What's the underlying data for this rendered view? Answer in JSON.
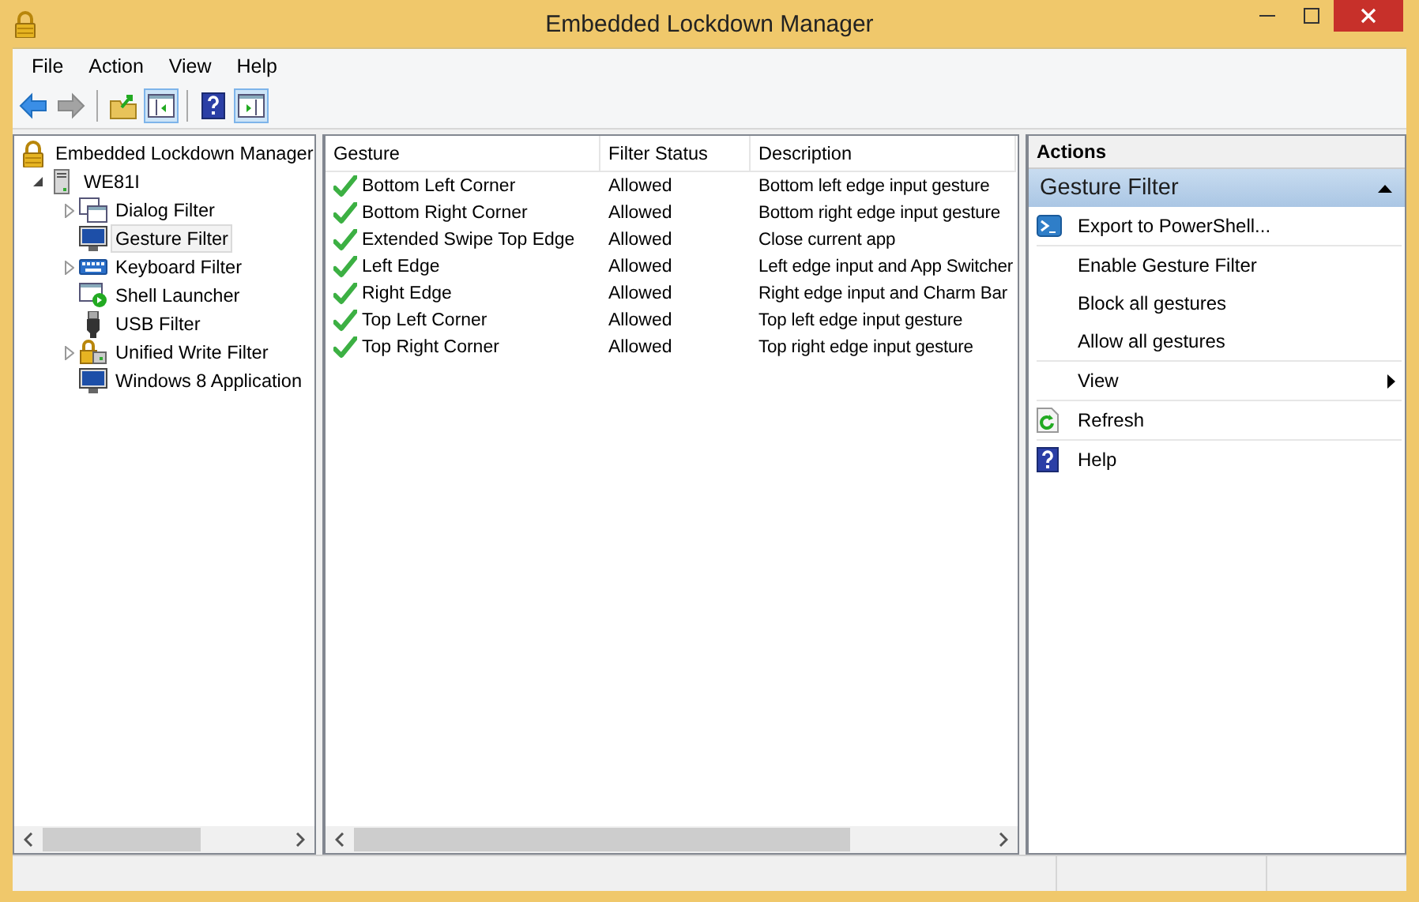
{
  "window": {
    "title": "Embedded Lockdown Manager"
  },
  "menu": [
    {
      "label": "File"
    },
    {
      "label": "Action"
    },
    {
      "label": "View"
    },
    {
      "label": "Help"
    }
  ],
  "toolbar": [
    {
      "pressed": false,
      "disabled": false
    },
    {
      "pressed": false,
      "disabled": true
    },
    {
      "pressed": false,
      "disabled": false
    },
    {
      "pressed": true,
      "disabled": false
    },
    {
      "pressed": false,
      "disabled": false
    },
    {
      "pressed": true,
      "disabled": false
    }
  ],
  "tree": [
    {
      "label": "Embedded Lockdown Manager",
      "expandable": false,
      "selected": false,
      "children": [
        {
          "label": "WE81I",
          "expandable": true,
          "expanded": true,
          "selected": false,
          "children": [
            {
              "label": "Dialog Filter",
              "expandable": true,
              "expanded": false,
              "selected": false
            },
            {
              "label": "Gesture Filter",
              "expandable": false,
              "selected": true
            },
            {
              "label": "Keyboard Filter",
              "expandable": true,
              "expanded": false,
              "selected": false
            },
            {
              "label": "Shell Launcher",
              "expandable": false,
              "selected": false
            },
            {
              "label": "USB Filter",
              "expandable": false,
              "selected": false
            },
            {
              "label": "Unified Write Filter",
              "expandable": true,
              "expanded": false,
              "selected": false
            },
            {
              "label": "Windows 8 Application",
              "expandable": false,
              "selected": false
            }
          ]
        }
      ]
    }
  ],
  "table": {
    "columns": [
      "Gesture",
      "Filter Status",
      "Description"
    ],
    "rows": [
      {
        "gesture": "Bottom Left Corner",
        "status": "Allowed",
        "description": "Bottom left edge input gesture",
        "allowed": true
      },
      {
        "gesture": "Bottom Right Corner",
        "status": "Allowed",
        "description": "Bottom right edge input gesture",
        "allowed": true
      },
      {
        "gesture": "Extended Swipe Top Edge",
        "status": "Allowed",
        "description": "Close current app",
        "allowed": true
      },
      {
        "gesture": "Left Edge",
        "status": "Allowed",
        "description": "Left edge input and App Switcher",
        "allowed": true
      },
      {
        "gesture": "Right Edge",
        "status": "Allowed",
        "description": "Right edge input and Charm Bar",
        "allowed": true
      },
      {
        "gesture": "Top Left Corner",
        "status": "Allowed",
        "description": "Top left edge input gesture",
        "allowed": true
      },
      {
        "gesture": "Top Right Corner",
        "status": "Allowed",
        "description": "Top right edge input gesture",
        "allowed": true
      }
    ]
  },
  "actions": {
    "title": "Actions",
    "section": {
      "title": "Gesture Filter",
      "expanded": true
    },
    "items": [
      {
        "label": "Export to PowerShell...",
        "kind": "export",
        "submenu": false,
        "divider_after": true
      },
      {
        "label": "Enable Gesture Filter",
        "kind": "plain",
        "submenu": false,
        "divider_after": false
      },
      {
        "label": "Block all gestures",
        "kind": "plain",
        "submenu": false,
        "divider_after": false
      },
      {
        "label": "Allow all gestures",
        "kind": "plain",
        "submenu": false,
        "divider_after": true
      },
      {
        "label": "View",
        "kind": "plain",
        "submenu": true,
        "divider_after": true
      },
      {
        "label": "Refresh",
        "kind": "refresh",
        "submenu": false,
        "divider_after": true
      },
      {
        "label": "Help",
        "kind": "help",
        "submenu": false,
        "divider_after": false
      }
    ]
  }
}
